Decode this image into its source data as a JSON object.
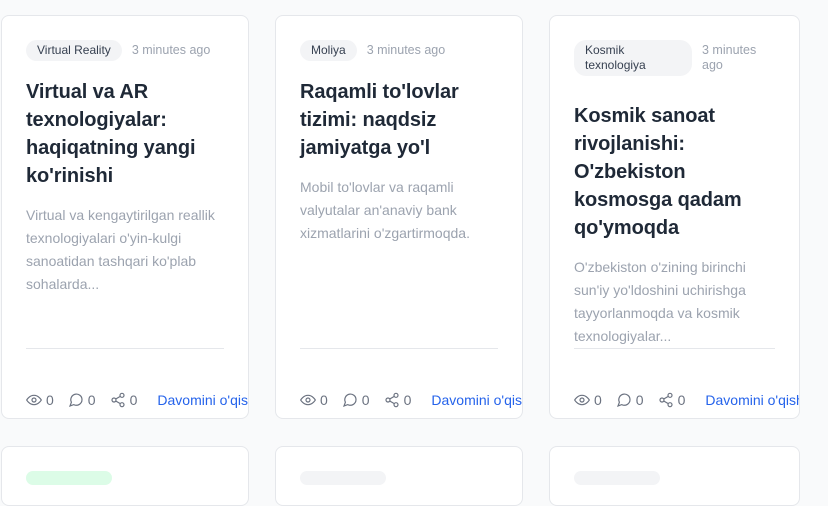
{
  "cards": [
    {
      "category": "Virtual Reality",
      "time": "3 minutes ago",
      "title": "Virtual va AR texnologiyalar: haqiqatning yangi ko'rinishi",
      "excerpt": "Virtual va kengaytirilgan reallik texnologiyalari o'yin-kulgi sanoatidan tashqari ko'plab sohalarda...",
      "views": "0",
      "comments": "0",
      "shares": "0",
      "read_more": "Davomini o'qish →"
    },
    {
      "category": "Moliya",
      "time": "3 minutes ago",
      "title": "Raqamli to'lovlar tizimi: naqdsiz jamiyatga yo'l",
      "excerpt": "Mobil to'lovlar va raqamli valyutalar an'anaviy bank xizmatlarini o'zgartirmoqda.",
      "views": "0",
      "comments": "0",
      "shares": "0",
      "read_more": "Davomini o'qish →"
    },
    {
      "category": "Kosmik texnologiya",
      "time": "3 minutes ago",
      "title": "Kosmik sanoat rivojlanishi: O'zbekiston kosmosga qadam qo'ymoqda",
      "excerpt": "O'zbekiston o'zining birinchi sun'iy yo'ldoshini uchirishga tayyorlanmoqda va kosmik texnologiyalar...",
      "views": "0",
      "comments": "0",
      "shares": "0",
      "read_more": "Davomini o'qish →"
    }
  ],
  "colors": {
    "accent": "#2563eb",
    "muted": "#9ca3af",
    "badge_bg": "#f3f4f6",
    "green_badge": "#dcfce7"
  },
  "icons": {
    "views": "eye-icon",
    "comments": "comment-icon",
    "shares": "share-icon"
  }
}
